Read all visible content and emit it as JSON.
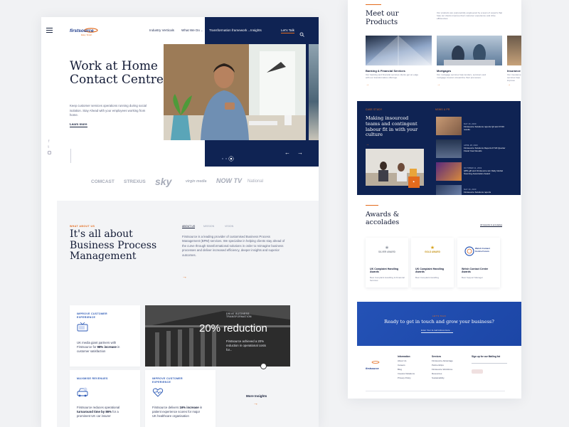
{
  "left": {
    "logo": "firstsource",
    "logo_tag": "Easy. Smart.",
    "nav": [
      "Industry Verticals",
      "What We Do",
      "Transformation framework",
      "Insights"
    ],
    "cta": "Let's Talk",
    "hero": {
      "title": "Work at Home Contact Centre.",
      "body": "Keep customer services operations running during social isolation. Stay Ahead with your employees working from home.",
      "link": "Learn more"
    },
    "clients": [
      "COMCAST",
      "STREXUS",
      "sky",
      "virgin media",
      "NOW TV",
      "National"
    ],
    "about": {
      "kicker": "WHAT ABOUT US",
      "title": "It's all about Business Process Management",
      "tabs": [
        "ABOUT US",
        "MISSION",
        "VISION"
      ],
      "body": "Firstsource is a leading provider of customised Business Process Management (BPM) services. We specialise in helping clients stay ahead of the curve through transformational solutions in order to reimagine business processes and deliver increased efficiency, deeper insights and superior outcomes."
    },
    "cards": [
      {
        "label": "IMPROVE CUSTOMER EXPERIENCE",
        "text_pre": "UK media giant partners with Firstsource for ",
        "text_bold": "98% increase",
        "text_post": " in customer satisfaction"
      },
      {
        "label": "DRIVE BUSINESS TRANSFORMATION",
        "headline": "20% reduction",
        "text": "Firstsource achieved a 20% reduction in operational costs for..."
      },
      {
        "label": "MAXIMISE REVENUES",
        "text_pre": "Firstsource reduces operational ",
        "text_bold": "turnaround time by 86%",
        "text_post": " for a prominent UK car insurer"
      },
      {
        "label": "IMPROVE CUSTOMER EXPERIENCE",
        "text_pre": "Firstsource delivers ",
        "text_bold": "16% increase",
        "text_post": " in patient experience scores for major UK healthcare organisation"
      }
    ],
    "more": "More Insights"
  },
  "right": {
    "products_title": "Meet our Products",
    "products_intro": "Our products are purposefully engineered by a team of experts that help our clients improve their customer experience and drive efficiencies.",
    "products": [
      {
        "title": "Banking & Financial Services",
        "desc": "Our banking and financial services clients get an edge with our transformative offerings."
      },
      {
        "title": "Mortgages",
        "desc": "Our mortgage services help lenders, servicers and mortgage insurers streamline their processes."
      },
      {
        "title": "Insurance",
        "desc": "Our insurance services help improve outcomes."
      }
    ],
    "feature": {
      "kicker": "CASE STUDY",
      "title": "Making insourced teams and contingent labour fit in with your culture",
      "news_kicker": "NEWS & PR",
      "news": [
        {
          "date": "MAY 26, 2020",
          "text": "Firstsource Solutions reports Q4 and FY20 results"
        },
        {
          "date": "APRIL 28, 2020",
          "text": "Firstsource Solutions Reports FY20 Quarter Fiscal Year Results"
        },
        {
          "date": "OCTOBER 11, 2019",
          "text": "QBS gift and Firstsource win Daily Global Sourcing Association Award"
        },
        {
          "date": "MAY 26, 2020",
          "text": "Firstsource Solutions reports"
        }
      ]
    },
    "awards_title": "Awards & accolades",
    "awards_link": "All Awards & accolades",
    "awards": [
      {
        "badge": "SILVER AWARD",
        "title": "UK Complaint Handling Awards",
        "sub": "Best Complaint Handling & Financial Services"
      },
      {
        "badge": "GOLD AWARD",
        "title": "UK Complaint Handling Awards",
        "sub": "Best Complaint Handling"
      },
      {
        "badge": "Welsh Contact Centre Forum",
        "title": "Welsh Contact Centre Awards",
        "sub": "Best Support Manager"
      }
    ],
    "cta_kicker": "LET'S TALK",
    "cta_title": "Ready to get in touch and grow your business?",
    "cta_button": "Enter Your E-mail Adress Here",
    "footer": {
      "col1_title": "Information",
      "col1": [
        "About Us",
        "Careers",
        "Blog",
        "Investor Relations",
        "Privacy Policy"
      ],
      "col2_title": "Services",
      "col2": [
        "Firstsource Advantage",
        "Partnerships",
        "Firstsource Workforce",
        "Resources",
        "Sustainability"
      ],
      "signup": "Sign up for our Mailing list"
    }
  }
}
